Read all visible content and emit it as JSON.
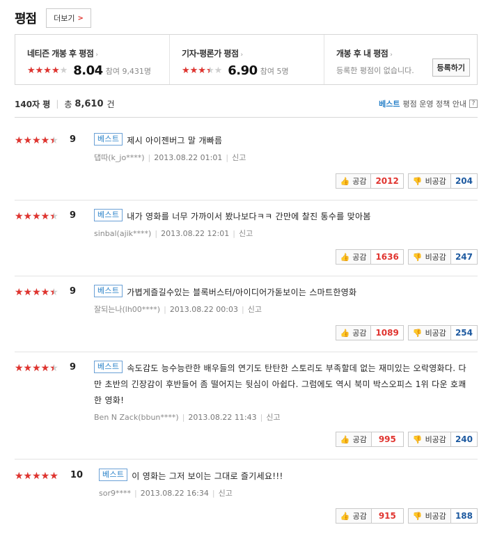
{
  "header": {
    "title": "평점",
    "more_label": "더보기",
    "more_arrow": ">"
  },
  "summary": {
    "netizen": {
      "label": "네티즌 개봉 후 평점",
      "score": "8.04",
      "participants": "참여 9,431명",
      "stars_fraction": 0.804
    },
    "critic": {
      "label": "기자·평론가 평점",
      "score": "6.90",
      "participants": "참여 5명",
      "stars_fraction": 0.69
    },
    "mine": {
      "label": "개봉 후 내 평점",
      "text": "등록한 평점이 없습니다.",
      "button_label": "등록하기"
    },
    "caret": "›"
  },
  "count": {
    "type_label": "140자 평",
    "total_label": "총",
    "total_value": "8,610",
    "unit": "건",
    "best_label": "베스트",
    "policy_label": "평점 운영 정책 안내",
    "help": "?"
  },
  "reviews": [
    {
      "score": "9",
      "stars_fraction": 0.9,
      "best": "베스트",
      "text": "제시 아이젠버그 말 개빠름",
      "author": "댑따(k_jo****)",
      "date": "2013.08.22 01:01",
      "report": "신고",
      "like_label": "공감",
      "like": "2012",
      "dislike_label": "비공감",
      "dislike": "204"
    },
    {
      "score": "9",
      "stars_fraction": 0.9,
      "best": "베스트",
      "text": "내가 영화를 너무 가까이서 봤나보다ㅋㅋ 간만에 찰진 통수를 맞아봄",
      "author": "sinbal(ajik****)",
      "date": "2013.08.22 12:01",
      "report": "신고",
      "like_label": "공감",
      "like": "1636",
      "dislike_label": "비공감",
      "dislike": "247"
    },
    {
      "score": "9",
      "stars_fraction": 0.9,
      "best": "베스트",
      "text": "가볍게즐길수있는 블록버스터/아이디어가돋보이는 스마트한영화",
      "author": "잘되는나(lh00****)",
      "date": "2013.08.22 00:03",
      "report": "신고",
      "like_label": "공감",
      "like": "1089",
      "dislike_label": "비공감",
      "dislike": "254"
    },
    {
      "score": "9",
      "stars_fraction": 0.9,
      "best": "베스트",
      "text": "속도감도 능수능란한 배우들의 연기도 탄탄한 스토리도 부족할데 없는 재미있는 오락영화다. 다만 초반의 긴장감이 후반들어 좀 떨어지는 뒷심이 아쉽다. 그럼에도 역시 북미 박스오피스 1위 다운 호쾌한 영화!",
      "author": "Ben N Zack(bbun****)",
      "date": "2013.08.22 11:43",
      "report": "신고",
      "like_label": "공감",
      "like": "995",
      "dislike_label": "비공감",
      "dislike": "240"
    },
    {
      "score": "10",
      "stars_fraction": 1.0,
      "best": "베스트",
      "text": "이 영화는 그저 보이는 그대로 즐기세요!!!",
      "author": "sor9****",
      "date": "2013.08.22 16:34",
      "report": "신고",
      "like_label": "공감",
      "like": "915",
      "dislike_label": "비공감",
      "dislike": "188"
    }
  ],
  "icons": {
    "star": "★",
    "thumb_up": "thumbs-up-icon",
    "thumb_down": "thumbs-down-icon"
  },
  "colors": {
    "star_active": "#e0342f",
    "star_inactive": "#cfcfcf",
    "best": "#2a82c9",
    "like": "#e0342f",
    "dislike": "#1e5aa0"
  }
}
